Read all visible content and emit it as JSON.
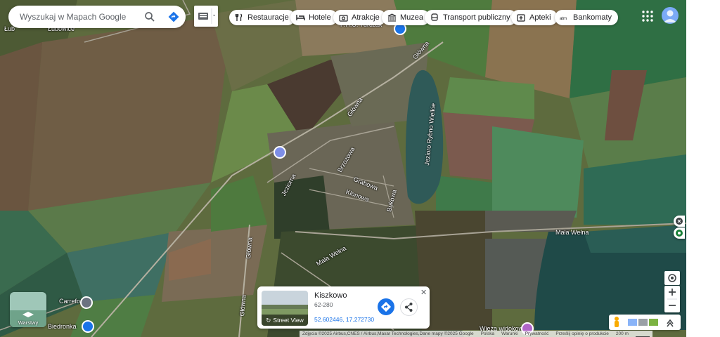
{
  "search": {
    "placeholder": "Wyszukaj w Mapach Google"
  },
  "chips": [
    {
      "label": "Restauracje",
      "icon": "fork-knife-icon"
    },
    {
      "label": "Hotele",
      "icon": "bed-icon"
    },
    {
      "label": "Atrakcje",
      "icon": "camera-icon"
    },
    {
      "label": "Muzea",
      "icon": "museum-icon"
    },
    {
      "label": "Transport publiczny",
      "icon": "bus-icon"
    },
    {
      "label": "Apteki",
      "icon": "pharmacy-icon"
    },
    {
      "label": "Bankomaty",
      "icon": "atm-icon"
    }
  ],
  "map_labels": {
    "glowna_n": "Główna",
    "glowna_mid": "Główna",
    "glowna_s": "Główna",
    "jeziorna": "Jeziorna",
    "lake": "Jezioro Rybno Wielkie",
    "brzozowa": "Brzozowa",
    "grabowa": "Grabowa",
    "klonowa": "Klonowa",
    "bukowa": "Bukowa",
    "mala_welna_w": "Mała Wełna",
    "mala_welna_e": "Mała Wełna",
    "wieza": "Wieża widokowa",
    "carrefour": "Carrefour",
    "biedronka": "Biedronka",
    "top_left": "Łub",
    "top_left2": "Łubowice",
    "top_center": "P.H.U. Turczak"
  },
  "layers_tile": {
    "label": "Warstwy"
  },
  "place_card": {
    "name": "Kiszkowo",
    "zip": "62-280",
    "coords": "52.602446, 17.272730",
    "street_view": "Street View"
  },
  "footer": {
    "attribution": "Zdjęcia ©2025 Airbus,CNES / Airbus,Maxar Technologies,Dane mapy ©2025 Google",
    "links": [
      "Polska",
      "Warunki",
      "Prywatność",
      "Prześlij opinię o produkcie"
    ],
    "scale": "200 m"
  },
  "colors": {
    "accent": "#1a73e8",
    "water": "#2f4f4f",
    "field_green": "#3d6b3a"
  }
}
